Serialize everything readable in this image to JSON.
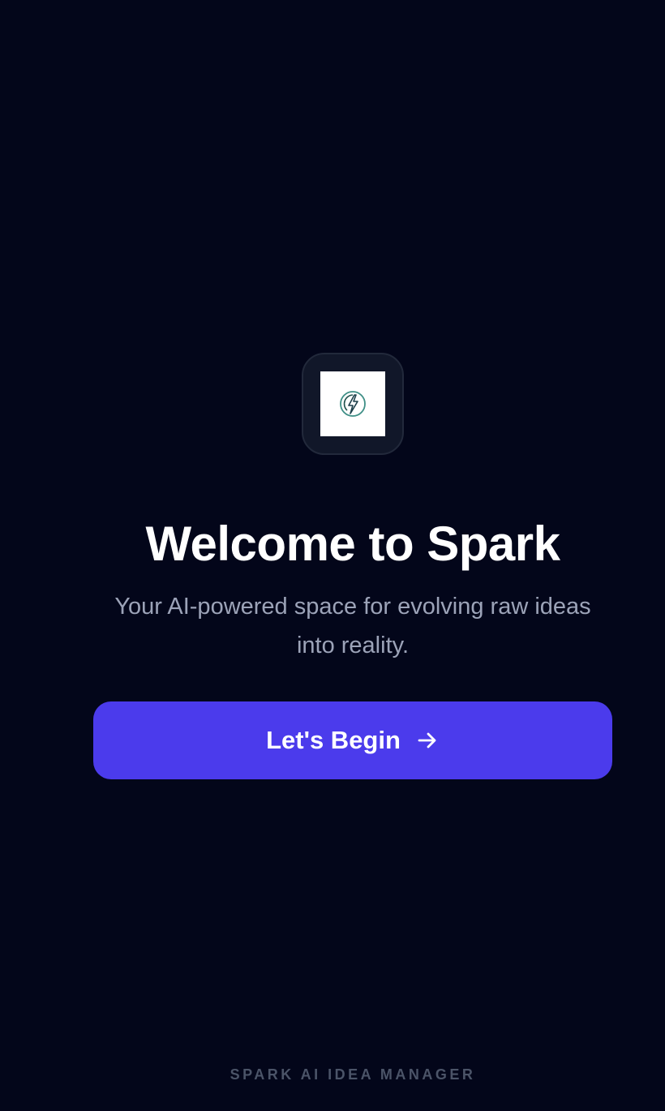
{
  "welcome": {
    "title": "Welcome to Spark",
    "subtitle": "Your AI-powered space for evolving raw ideas into reality.",
    "cta_label": "Let's Begin",
    "cta_icon": "arrow-right-icon",
    "logo_icon": "lightning-bolt-icon"
  },
  "footer": {
    "label": "SPARK AI IDEA MANAGER"
  },
  "colors": {
    "background": "#03061a",
    "accent": "#4b3bec",
    "logo_teal": "#3f8f86"
  }
}
